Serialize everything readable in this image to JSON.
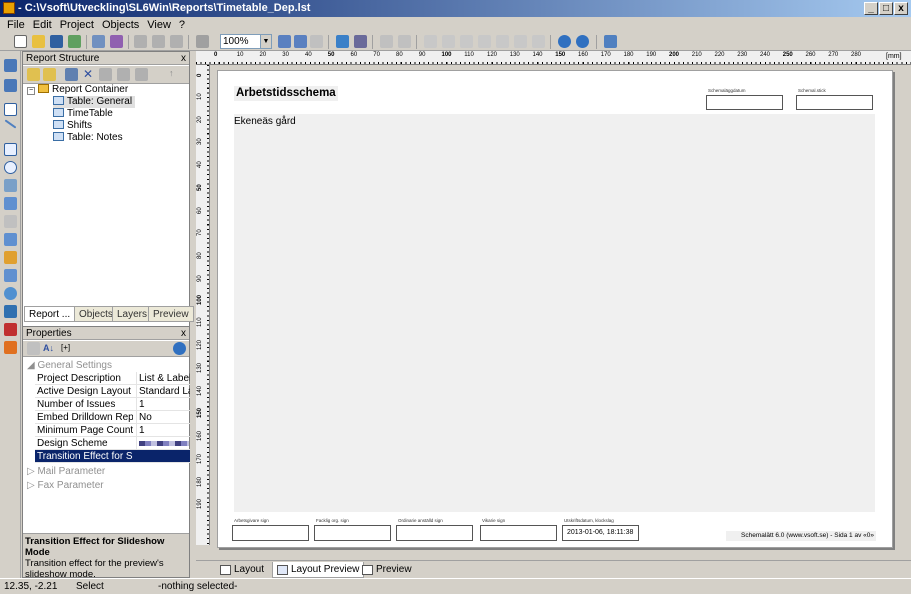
{
  "window": {
    "title": "- C:\\Vsoft\\Utveckling\\SL6Win\\Reports\\Timetable_Dep.lst",
    "minimize": "_",
    "maximize": "□",
    "close": "x"
  },
  "menu": [
    "File",
    "Edit",
    "Project",
    "Objects",
    "View",
    "?"
  ],
  "toolbar": {
    "zoom": "100%",
    "ruler_unit": "[mm]"
  },
  "report_structure": {
    "title": "Report Structure",
    "close": "x",
    "items": [
      {
        "label": "Report Container",
        "level": 0
      },
      {
        "label": "Table: General",
        "level": 1,
        "selected": true
      },
      {
        "label": "TimeTable",
        "level": 1
      },
      {
        "label": "Shifts",
        "level": 1
      },
      {
        "label": "Table: Notes",
        "level": 1
      }
    ],
    "tabs": [
      "Report ...",
      "Objects",
      "Layers",
      "Preview"
    ]
  },
  "properties": {
    "title": "Properties",
    "close": "x",
    "sort_label": "[+]",
    "categories": [
      "General Settings",
      "Mail Parameter",
      "Fax Parameter"
    ],
    "rows": [
      {
        "key": "Project Description",
        "value": "List & Label..."
      },
      {
        "key": "Active Design Layout",
        "value": "Standard La..."
      },
      {
        "key": "Number of Issues",
        "value": "1"
      },
      {
        "key": "Embed Drilldown Reports",
        "value": "No"
      },
      {
        "key": "Minimum Page Count",
        "value": "1"
      },
      {
        "key": "Design Scheme",
        "value": ""
      },
      {
        "key": "Transition Effect for Slid...",
        "value": "",
        "selected": true
      }
    ],
    "help_title": "Transition Effect for Slideshow Mode",
    "help_text": "Transition effect for the preview's slideshow mode."
  },
  "ruler": {
    "h_labels": [
      "0",
      "10",
      "20",
      "30",
      "40",
      "50",
      "60",
      "70",
      "80",
      "90",
      "100",
      "110",
      "120",
      "130",
      "140",
      "150",
      "160",
      "170",
      "180",
      "190",
      "200",
      "210",
      "220",
      "230",
      "240",
      "250",
      "260",
      "270",
      "280"
    ],
    "v_labels": [
      "0",
      "10",
      "20",
      "30",
      "40",
      "50",
      "60",
      "70",
      "80",
      "90",
      "100",
      "110",
      "120",
      "130",
      "140",
      "150",
      "160",
      "170",
      "180",
      "190"
    ]
  },
  "report": {
    "heading": "Arbetstidsschema",
    "subheading": "Ekeneäs gård",
    "top_boxes": [
      {
        "label": "Schemaläggdatum"
      },
      {
        "label": "Schemal.stick"
      }
    ],
    "footer_boxes": [
      {
        "label": "Arbetsgivare sign",
        "value": ""
      },
      {
        "label": "Facklig org. sign",
        "value": ""
      },
      {
        "label": "Ordinarie anställd sign",
        "value": ""
      },
      {
        "label": "Vikarie sign",
        "value": ""
      },
      {
        "label": "Utskriftsdatum, klockslag",
        "value": "2013-01-06, 18:11:38"
      }
    ],
    "footer_text": "Schemalätt 6.0 (www.vsoft.se) - Sida 1 av «0»"
  },
  "bottom_tabs": [
    "Layout",
    "Layout Preview",
    "Preview"
  ],
  "status": {
    "coords": "12.35, -2.21",
    "mode": "Select",
    "selection": "-nothing selected-"
  }
}
